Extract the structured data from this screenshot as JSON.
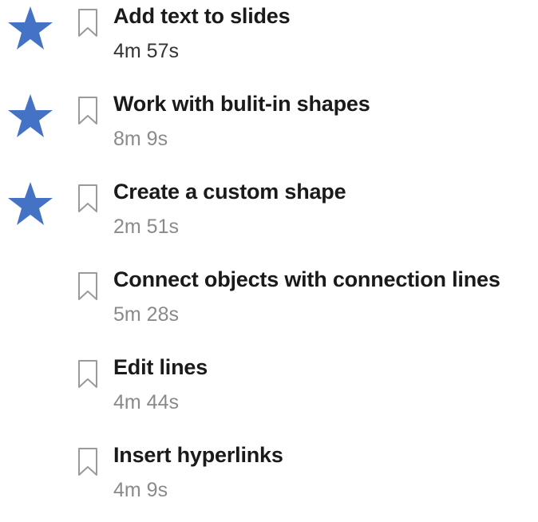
{
  "colors": {
    "star": "#4472c4",
    "bookmark": "#9a9a9a",
    "title": "#1a1a1a",
    "duration": "#8a8a8a",
    "duration_current": "#333333"
  },
  "icons": {
    "star": "star-icon",
    "bookmark": "bookmark-icon"
  },
  "videos": [
    {
      "title": "Add text to slides",
      "duration": "4m 57s",
      "starred": true,
      "current": true
    },
    {
      "title": "Work with bulit-in shapes",
      "duration": "8m 9s",
      "starred": true,
      "current": false
    },
    {
      "title": "Create a custom shape",
      "duration": "2m 51s",
      "starred": true,
      "current": false
    },
    {
      "title": "Connect objects with connection lines",
      "duration": "5m 28s",
      "starred": false,
      "current": false
    },
    {
      "title": "Edit lines",
      "duration": "4m 44s",
      "starred": false,
      "current": false
    },
    {
      "title": "Insert hyperlinks",
      "duration": "4m 9s",
      "starred": false,
      "current": false
    }
  ]
}
